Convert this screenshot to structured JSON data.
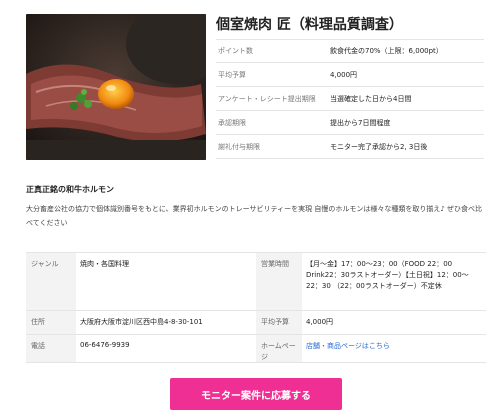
{
  "shop": {
    "name": "個室焼肉 匠（料理品質調査）"
  },
  "info": [
    {
      "label": "ポイント数",
      "value": "飲食代金の70%（上限：6,000pt）"
    },
    {
      "label": "平均予算",
      "value": "4,000円"
    },
    {
      "label": "アンケート・レシート提出期限",
      "value": "当選確定した日から4日間"
    },
    {
      "label": "承認期限",
      "value": "提出から7日間程度"
    },
    {
      "label": "謝礼付与期限",
      "value": "モニター完了承認から2, 3日後"
    }
  ],
  "feature": {
    "title": "正真正銘の和牛ホルモン",
    "text": "大分畜産公社の協力で個体識別番号をもとに、業界初ホルモンのトレーサビリティーを実現 自慢のホルモンは様々な種類を取り揃え♪ ぜひ食べ比べてください"
  },
  "details": {
    "genre_label": "ジャンル",
    "genre_value": "焼肉・各国料理",
    "hours_label": "営業時間",
    "hours_value": "【月〜金】17：00〜23：00（FOOD 22：00 Drink22：30ラストオーダー）【土日祝】12：00〜22：30 （22：00ラストオーダー）不定休",
    "address_label": "住所",
    "address_value": "大阪府大阪市淀川区西中島4-8-30-101",
    "budget_label": "平均予算",
    "budget_value": "4,000円",
    "phone_label": "電話",
    "phone_value": "06-6476-9939",
    "homepage_label": "ホームページ",
    "homepage_value": "店舗・商品ページはこちら"
  },
  "apply_button": "モニター案件に応募する"
}
